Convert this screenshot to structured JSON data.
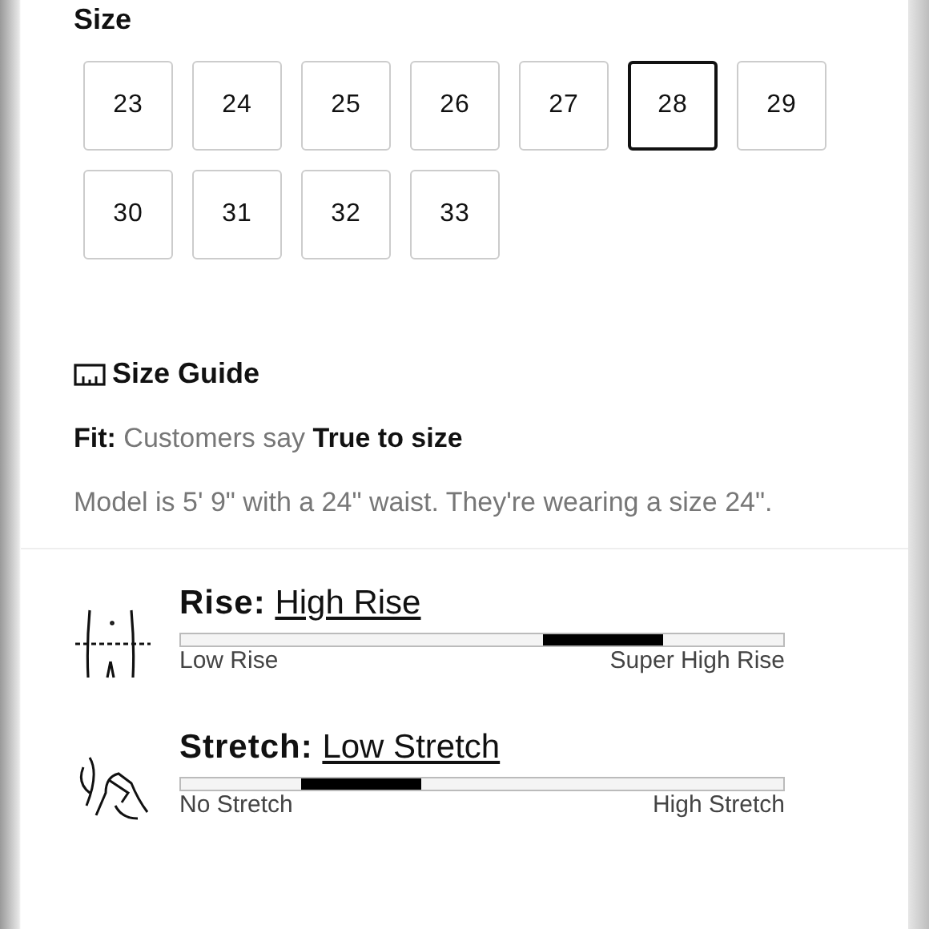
{
  "size_section": {
    "title": "Size",
    "sizes": [
      {
        "label": "23",
        "selected": false
      },
      {
        "label": "24",
        "selected": false
      },
      {
        "label": "25",
        "selected": false
      },
      {
        "label": "26",
        "selected": false
      },
      {
        "label": "27",
        "selected": false
      },
      {
        "label": "28",
        "selected": true
      },
      {
        "label": "29",
        "selected": false
      },
      {
        "label": "30",
        "selected": false
      },
      {
        "label": "31",
        "selected": false
      },
      {
        "label": "32",
        "selected": false
      },
      {
        "label": "33",
        "selected": false
      }
    ]
  },
  "size_guide": {
    "label": "Size Guide"
  },
  "fit": {
    "label": "Fit:",
    "text": "Customers say",
    "value": "True to size"
  },
  "model_note": "Model is 5' 9\" with a 24\" waist. They're wearing a size 24\".",
  "attributes": [
    {
      "kind": "rise",
      "label": "Rise:",
      "value": "High Rise",
      "min_label": "Low Rise",
      "max_label": "Super High Rise",
      "segments": [
        {
          "selected": false
        },
        {
          "selected": false
        },
        {
          "selected": false
        },
        {
          "selected": true
        },
        {
          "selected": false
        }
      ]
    },
    {
      "kind": "stretch",
      "label": "Stretch:",
      "value": "Low Stretch",
      "min_label": "No Stretch",
      "max_label": "High Stretch",
      "segments": [
        {
          "selected": false
        },
        {
          "selected": true
        },
        {
          "selected": false
        },
        {
          "selected": false
        },
        {
          "selected": false
        }
      ]
    }
  ]
}
